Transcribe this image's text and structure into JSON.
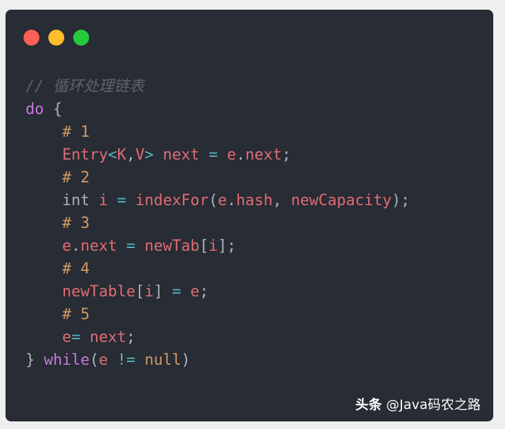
{
  "window": {
    "controls": [
      {
        "name": "close",
        "color": "#ff5f56"
      },
      {
        "name": "minimize",
        "color": "#ffbd2e"
      },
      {
        "name": "maximize",
        "color": "#27c93f"
      }
    ]
  },
  "code": {
    "lines": [
      [
        {
          "t": "// 循环处理链表",
          "c": "comment"
        }
      ],
      [
        {
          "t": "do",
          "c": "keyword"
        },
        {
          "t": " {",
          "c": "punc"
        }
      ],
      [
        {
          "t": "    # 1",
          "c": "number"
        }
      ],
      [
        {
          "t": "    ",
          "c": "punc"
        },
        {
          "t": "Entry",
          "c": "var"
        },
        {
          "t": "<",
          "c": "op"
        },
        {
          "t": "K",
          "c": "var"
        },
        {
          "t": ",",
          "c": "punc"
        },
        {
          "t": "V",
          "c": "var"
        },
        {
          "t": ">",
          "c": "op"
        },
        {
          "t": " next",
          "c": "var"
        },
        {
          "t": " = ",
          "c": "op"
        },
        {
          "t": "e",
          "c": "var"
        },
        {
          "t": ".",
          "c": "punc"
        },
        {
          "t": "next",
          "c": "var"
        },
        {
          "t": ";",
          "c": "punc"
        }
      ],
      [
        {
          "t": "    # 2",
          "c": "number"
        }
      ],
      [
        {
          "t": "    ",
          "c": "punc"
        },
        {
          "t": "int",
          "c": "type"
        },
        {
          "t": " i",
          "c": "var"
        },
        {
          "t": " = ",
          "c": "op"
        },
        {
          "t": "indexFor",
          "c": "var"
        },
        {
          "t": "(",
          "c": "punc"
        },
        {
          "t": "e",
          "c": "var"
        },
        {
          "t": ".",
          "c": "punc"
        },
        {
          "t": "hash",
          "c": "var"
        },
        {
          "t": ", ",
          "c": "punc"
        },
        {
          "t": "newCapacity",
          "c": "var"
        },
        {
          "t": ");",
          "c": "punc"
        }
      ],
      [
        {
          "t": "    # 3",
          "c": "number"
        }
      ],
      [
        {
          "t": "    ",
          "c": "punc"
        },
        {
          "t": "e",
          "c": "var"
        },
        {
          "t": ".",
          "c": "punc"
        },
        {
          "t": "next",
          "c": "var"
        },
        {
          "t": " = ",
          "c": "op"
        },
        {
          "t": "newTab",
          "c": "var"
        },
        {
          "t": "[",
          "c": "punc"
        },
        {
          "t": "i",
          "c": "var"
        },
        {
          "t": "];",
          "c": "punc"
        }
      ],
      [
        {
          "t": "    # 4",
          "c": "number"
        }
      ],
      [
        {
          "t": "    ",
          "c": "punc"
        },
        {
          "t": "newTable",
          "c": "var"
        },
        {
          "t": "[",
          "c": "punc"
        },
        {
          "t": "i",
          "c": "var"
        },
        {
          "t": "]",
          "c": "punc"
        },
        {
          "t": " = ",
          "c": "op"
        },
        {
          "t": "e",
          "c": "var"
        },
        {
          "t": ";",
          "c": "punc"
        }
      ],
      [
        {
          "t": "    # 5",
          "c": "number"
        }
      ],
      [
        {
          "t": "    ",
          "c": "punc"
        },
        {
          "t": "e",
          "c": "var"
        },
        {
          "t": "= ",
          "c": "op"
        },
        {
          "t": "next",
          "c": "var"
        },
        {
          "t": ";",
          "c": "punc"
        }
      ],
      [
        {
          "t": "} ",
          "c": "punc"
        },
        {
          "t": "while",
          "c": "keyword"
        },
        {
          "t": "(",
          "c": "punc"
        },
        {
          "t": "e",
          "c": "var"
        },
        {
          "t": " != ",
          "c": "op"
        },
        {
          "t": "null",
          "c": "number"
        },
        {
          "t": ")",
          "c": "punc"
        }
      ]
    ]
  },
  "watermark": {
    "brand": "头条",
    "handle": " @Java码农之路"
  }
}
